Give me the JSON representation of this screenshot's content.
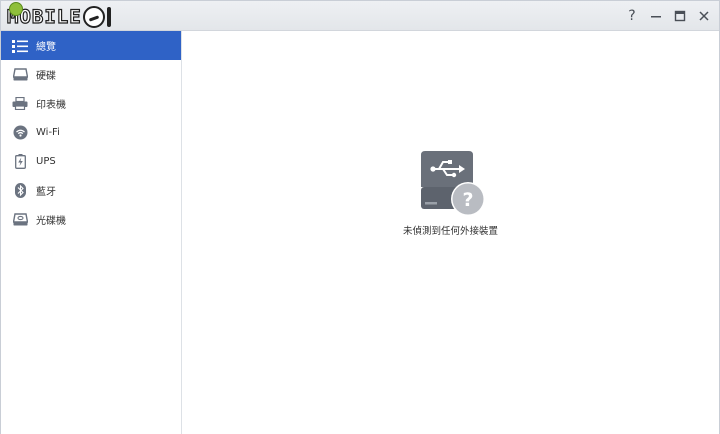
{
  "window": {
    "logo_text": "MOBILE",
    "controls": {
      "help": "?",
      "minimize": "—",
      "maximize": "□",
      "close": "✕"
    }
  },
  "sidebar": {
    "items": [
      {
        "label": "總覽",
        "icon": "list-icon",
        "active": true
      },
      {
        "label": "硬碟",
        "icon": "hard-drive-icon",
        "active": false
      },
      {
        "label": "印表機",
        "icon": "printer-icon",
        "active": false
      },
      {
        "label": "Wi-Fi",
        "icon": "wifi-icon",
        "active": false
      },
      {
        "label": "UPS",
        "icon": "battery-icon",
        "active": false
      },
      {
        "label": "藍牙",
        "icon": "bluetooth-icon",
        "active": false
      },
      {
        "label": "光碟機",
        "icon": "optical-drive-icon",
        "active": false
      }
    ]
  },
  "main": {
    "empty_message": "未偵測到任何外接裝置",
    "empty_icon": "usb-drive-unknown-icon"
  },
  "colors": {
    "active_item": "#2f62c6",
    "icon_gray": "#6b7380",
    "drive_gray": "#6a707a",
    "question_gray": "#b9bcc2"
  }
}
